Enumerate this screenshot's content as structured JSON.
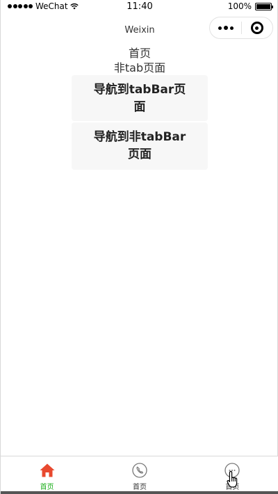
{
  "status_bar": {
    "carrier": "WeChat",
    "time": "11:40",
    "battery": "100%"
  },
  "nav_bar": {
    "title": "Weixin",
    "more_icon": "more-dots-icon",
    "close_icon": "close-target-icon"
  },
  "content": {
    "line1": "首页",
    "line2": "非tab页面",
    "button1": "导航到tabBar页面",
    "button2": "导航到非tabBar页面"
  },
  "tab_bar": {
    "active_color": "#1aad19",
    "items": [
      {
        "label": "首页",
        "icon": "home-icon",
        "active": true
      },
      {
        "label": "首页",
        "icon": "phone-icon",
        "active": false
      },
      {
        "label": "首页",
        "icon": "chat-icon",
        "active": false
      }
    ]
  }
}
